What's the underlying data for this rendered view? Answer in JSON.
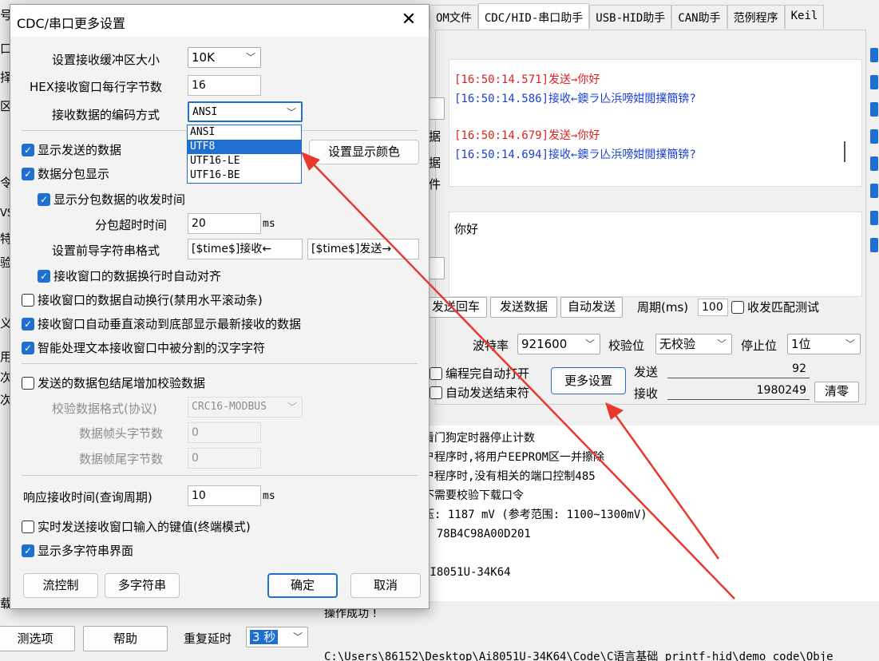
{
  "background": {
    "tabs": [
      "OM文件",
      "CDC/HID-串口助手",
      "USB-HID助手",
      "CAN助手",
      "范例程序",
      "Keil"
    ],
    "active_tab": 1,
    "left_fragments": [
      "号",
      "口",
      "择",
      "区",
      "令",
      "VS",
      "特",
      "验",
      "义",
      "用",
      "次",
      "次",
      "载"
    ],
    "recv_lines": [
      {
        "text": "[16:50:14.571]发送→你好",
        "color": "#e02020"
      },
      {
        "text": "[16:50:14.586]接收←鐭ラ亾浜嗙姏閲撲簡锛?",
        "color": "#1a3fd6"
      },
      {
        "text": "",
        "color": "#000"
      },
      {
        "text": "[16:50:14.679]发送→你好",
        "color": "#e02020"
      },
      {
        "text": "[16:50:14.694]接收←鐭ラ亾浜嗙姏閲撲簡锛?",
        "color": "#1a3fd6"
      }
    ],
    "side_labels": [
      "据",
      "据",
      "件"
    ],
    "send_text": "你好",
    "send_row": {
      "send_enter": "发送回车",
      "send_data": "发送数据",
      "auto_send": "自动发送",
      "period_label": "周期(ms)",
      "period_value": "100",
      "match_test": "收发匹配测试"
    },
    "port_row": {
      "baud_label": "波特率",
      "baud_value": "921600",
      "parity_label": "校验位",
      "parity_value": "无校验",
      "stop_label": "停止位",
      "stop_value": "1位"
    },
    "more_row": {
      "auto_open": "编程完自动打开",
      "auto_stop": "自动发送结束符",
      "more_settings": "更多设置",
      "send_label": "发送",
      "send_count": "92",
      "recv_label": "接收",
      "recv_count": "1980249",
      "clear": "清零"
    },
    "log_lines": [
      "看门狗定时器停止计数",
      "户程序时,将用户EEPROM区一并擦除",
      "户程序时,没有相关的端口控制485",
      "不需要校验下载口令",
      "压: 1187 mV (参考范围: 1100~1300mV)",
      ": 78B4C98A00D201",
      "",
      "AI8051U-34K64"
    ],
    "log_bottom": "操作成功 !",
    "bottom_left": {
      "options": "测选项",
      "help": "帮助",
      "repeat_delay": "重复延时",
      "delay_value": "3 秒"
    },
    "path_text": "C:\\Users\\86152\\Desktop\\Ai8051U-34K64\\Code\\C语言基础 printf-hid\\demo code\\Obje"
  },
  "dialog": {
    "title": "CDC/串口更多设置",
    "buffer_label": "设置接收缓冲区大小",
    "buffer_value": "10K",
    "hex_bytes_label": "HEX接收窗口每行字节数",
    "hex_bytes_value": "16",
    "encoding_label": "接收数据的编码方式",
    "encoding_value": "ANSI",
    "encoding_options": [
      "ANSI",
      "UTF8",
      "UTF16-LE",
      "UTF16-BE"
    ],
    "encoding_highlight": 1,
    "show_sent": "显示发送的数据",
    "set_color": "设置显示颜色",
    "packet_show": "数据分包显示",
    "packet_time": "显示分包数据的收发时间",
    "timeout_label": "分包超时时间",
    "timeout_value": "20",
    "timeout_unit": "ms",
    "prefix_label": "设置前导字符串格式",
    "prefix_recv": "[$time$]接收←",
    "prefix_send": "[$time$]发送→",
    "auto_align": "接收窗口的数据换行时自动对齐",
    "auto_wrap": "接收窗口的数据自动换行(禁用水平滚动条)",
    "auto_scroll": "接收窗口自动垂直滚动到底部显示最新接收的数据",
    "smart_split": "智能处理文本接收窗口中被分割的汉字字符",
    "checksum_append": "发送的数据包结尾增加校验数据",
    "checksum_format_label": "校验数据格式(协议)",
    "checksum_format_value": "CRC16-MODBUS",
    "frame_head_label": "数据帧头字节数",
    "frame_head_value": "0",
    "frame_tail_label": "数据帧尾字节数",
    "frame_tail_value": "0",
    "response_label": "响应接收时间(查询周期)",
    "response_value": "10",
    "response_unit": "ms",
    "realtime_send": "实时发送接收窗口输入的键值(终端模式)",
    "multi_string": "显示多字符串界面",
    "flow_control": "流控制",
    "multi_string_btn": "多字符串",
    "ok": "确定",
    "cancel": "取消"
  },
  "colors": {
    "accent": "#1f6fd1",
    "arrow": "#e8392e",
    "recv": "#1a3fd6",
    "send": "#e02020"
  }
}
